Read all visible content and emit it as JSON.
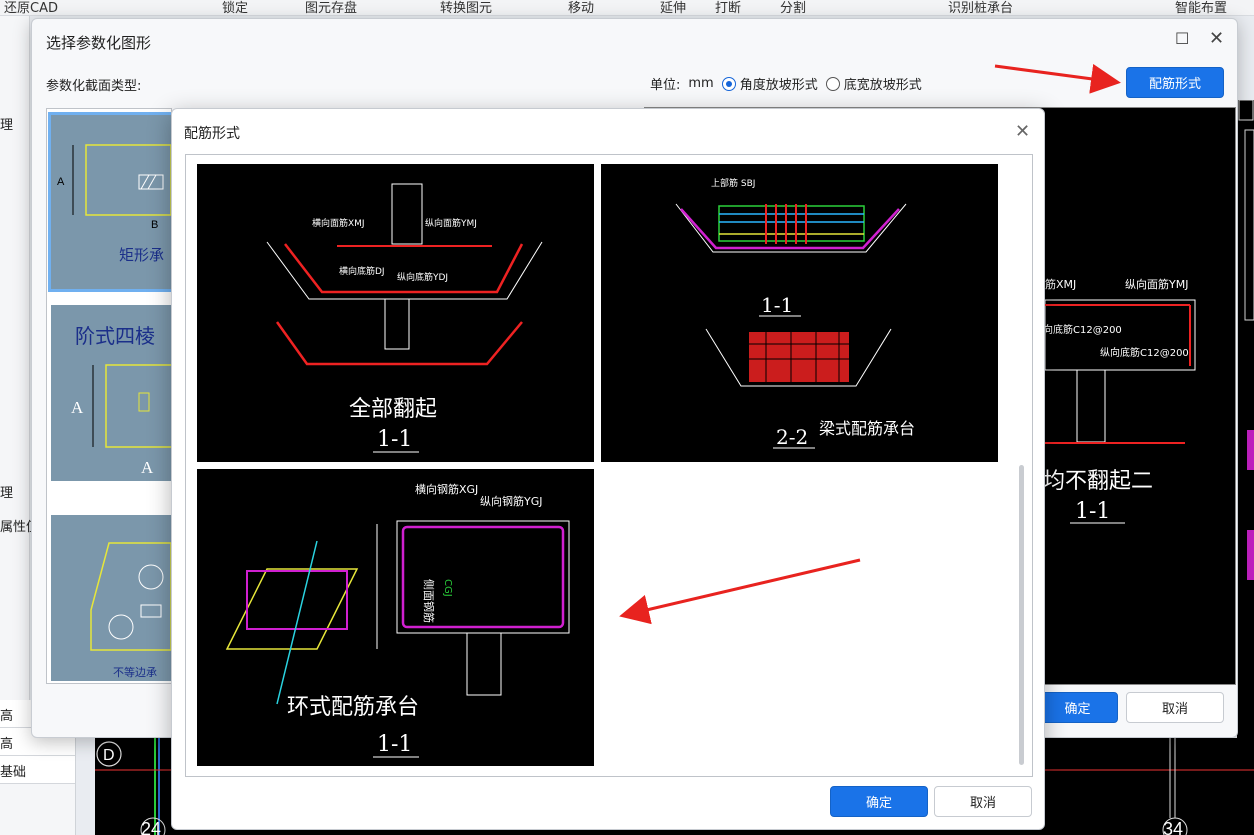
{
  "app": {
    "topbar": [
      "还原CAD",
      "锁定",
      "图元存盘",
      "转换图元",
      "移动",
      "延伸",
      "打断",
      "分割",
      "识别桩承台",
      "智能布置"
    ],
    "left_labels": [
      "理",
      "理",
      "属性值"
    ],
    "left_panel_rows": [
      "高",
      "高",
      "基础"
    ],
    "axis_labels": [
      "D",
      "24",
      "34"
    ]
  },
  "outer_dialog": {
    "title": "选择参数化图形",
    "section_label": "参数化截面类型:",
    "unit_label": "单位:",
    "unit_value": "mm",
    "radio_options": [
      {
        "label": "角度放坡形式",
        "checked": true
      },
      {
        "label": "底宽放坡形式",
        "checked": false
      }
    ],
    "rebar_form_button": "配筋形式",
    "ok_button": "确定",
    "cancel_button": "取消",
    "types": [
      "矩形承",
      "阶式四棱",
      "不等边承"
    ],
    "preview_texts": [
      "均不翻起二",
      "1-1"
    ]
  },
  "inner_dialog": {
    "title": "配筋形式",
    "ok_button": "确定",
    "cancel_button": "取消",
    "options": [
      {
        "label": "全部翻起",
        "section": "1-1"
      },
      {
        "label": "梁式配筋承台",
        "section": "1-1",
        "section2": "2-2"
      },
      {
        "label": "环式配筋承台",
        "section": "1-1"
      }
    ]
  },
  "colors": {
    "accent": "#1a73e8",
    "arrow": "#e8231f"
  }
}
